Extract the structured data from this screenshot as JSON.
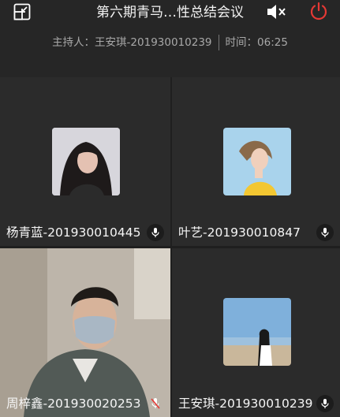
{
  "meeting": {
    "title": "第六期青马…性总结会议",
    "host_label": "主持人：王安琪-201930010239",
    "time_label": "时间：06:25"
  },
  "icons": {
    "shrink": "shrink-window-icon",
    "mute": "speaker-mute-icon",
    "power": "power-icon",
    "mic": "microphone-icon",
    "mic_off": "microphone-off-icon"
  },
  "colors": {
    "power_red": "#e53935",
    "background": "#2a2a2a"
  },
  "participants": [
    {
      "name": "杨青蓝-201930010445",
      "mic": "on",
      "video": false
    },
    {
      "name": "叶艺-201930010847",
      "mic": "on",
      "video": false
    },
    {
      "name": "周梓鑫-201930020253",
      "mic": "off",
      "video": true
    },
    {
      "name": "王安琪-201930010239",
      "mic": "on",
      "video": false
    }
  ]
}
